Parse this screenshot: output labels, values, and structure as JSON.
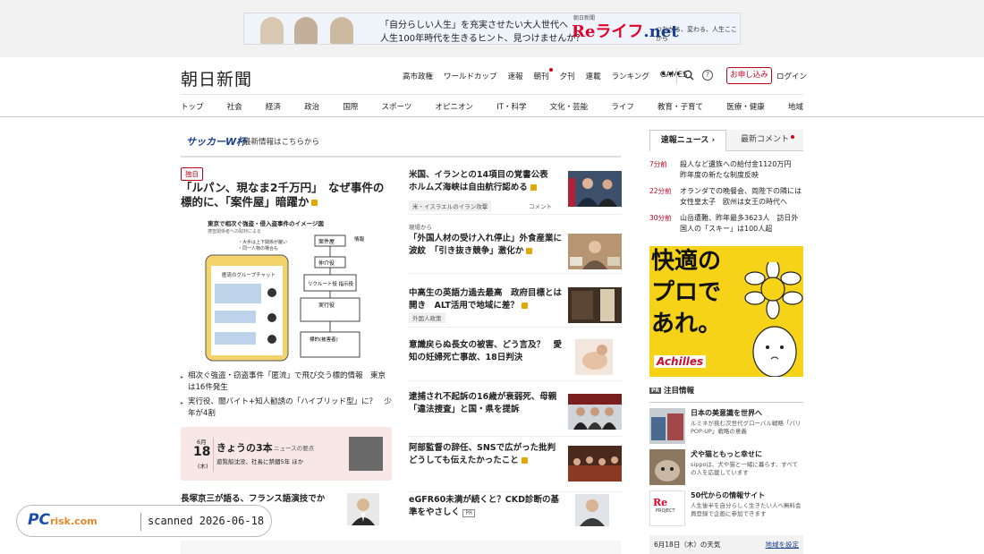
{
  "banner": {
    "line1": "「自分らしい人生」を充実させたい大人世代へ",
    "line2": "人生100年時代を生きるヒント、見つけませんか？",
    "brand_small": "朝日新聞",
    "brand_main": "Reライフ",
    "brand_net": ".net",
    "tagline": "つながる、変わる、人生ここから"
  },
  "header": {
    "logo": "朝日新聞",
    "top_links": [
      "高市政権",
      "ワールドカップ",
      "速報",
      "朝刊",
      "夕刊",
      "連載",
      "ランキング",
      "GAMES"
    ],
    "more": "•••",
    "subscribe": "お申し込み",
    "login": "ログイン",
    "categories": [
      "トップ",
      "社会",
      "経済",
      "政治",
      "国際",
      "スポーツ",
      "オピニオン",
      "IT・科学",
      "文化・芸能",
      "ライフ",
      "教育・子育て",
      "医療・健康",
      "地域"
    ]
  },
  "worldcup": {
    "label": "サッカーW杯",
    "text": "最新情報はこちらから"
  },
  "lead": {
    "badge": "独自",
    "title": "「ルパン、現なま2千万円」　なぜ事件の標的に、「案件屋」暗躍か",
    "diagram_title": "東京で相次ぐ強盗・侵入盗事件のイメージ図",
    "diagram_sub": "捜査関係者への取材による",
    "diagram_note1": "・大手は上下関係が厳い",
    "diagram_note2": "・同一人物の場合も",
    "diagram_chat": "匿流のグループチャット",
    "diagram_roles": [
      "案件屋",
      "仲介役",
      "リクルート役 指示役",
      "実行役",
      "標的(被害者)"
    ],
    "diagram_info": "情報",
    "related": [
      "相次ぐ強盗・窃盗事件「匿流」で飛び交う標的情報　東京は16件発生",
      "実行役、闇バイト+知人勧誘の「ハイブリッド型」に？　少年が4割"
    ]
  },
  "today3": {
    "month": "6月",
    "day": "18",
    "weekday": "(木)",
    "title": "きょうの3本",
    "tag": "ニュースの要点",
    "sub": "遊覧船沈没、社長に禁錮5年 ほか"
  },
  "bottom_left": {
    "title": "長塚京三が語る、フランス語演技でか"
  },
  "stories": [
    {
      "title": "米国、イランとの14項目の覚書公表　ホルムズ海峡は自由航行認める",
      "tag": "米・イスラエルのイラン攻撃",
      "comment": "コメント"
    },
    {
      "pre": "現場から",
      "title": "「外国人材の受け入れ停止」外食産業に波紋　「引き抜き競争」激化か",
      "tag": "外国人政策"
    },
    {
      "title": "中高生の英語力過去最高　政府目標とは開き　ALT活用で地域に差？"
    },
    {
      "title": "意識戻らぬ長女の被害、どう言及？　愛知の妊婦死亡事故、18日判決"
    },
    {
      "title": "逮捕され不起訴の16歳が衰弱死、母親「違法捜査」と国・県を提訴"
    },
    {
      "title": "阿部監督の辞任、SNSで広がった批判　どうしても伝えたかったこと"
    },
    {
      "title": "eGFR60未満が続くと？CKD診断の基準をやさしく",
      "pr": "PR"
    }
  ],
  "right": {
    "tab_flash": "速報ニュース",
    "tab_comments": "最新コメント",
    "flash": [
      {
        "time": "7分前",
        "text": "殺人など遺族への給付金1120万円　昨年度の新たな制度反映"
      },
      {
        "time": "22分前",
        "text": "オランダでの晩餐会、両陛下の隣には女性皇太子　欧州は女王の時代へ"
      },
      {
        "time": "30分前",
        "text": "山岳遭難、昨年最多3623人　訪日外国人の「スキー」は100人超"
      }
    ],
    "ad_text": "快適の\nプロで\nあれ。",
    "ad_brand": "Achilles",
    "attention_label": "注目情報",
    "attention_pr": "PR",
    "promos": [
      {
        "h": "日本の美意識を世界へ",
        "s": "ルミネが挑む次世代グローバル戦略「パリPOP-UP」戦略の意義"
      },
      {
        "h": "犬や猫ともっと幸せに",
        "s": "sippoは、犬や猫と一緒に暮らす、すべての人を応援しています"
      },
      {
        "h": "50代からの情報サイト",
        "s": "人生後半を自分らしく生きたい人へ無料会員登録で企画に参加できます",
        "img_label": "PROJECT"
      }
    ],
    "weather_date": "6月18日（木）の天気",
    "weather_link": "地域を設定"
  },
  "watermark": {
    "logo": "PC",
    "logo_risk": "risk.com",
    "scanned": "scanned 2026-06-18"
  }
}
